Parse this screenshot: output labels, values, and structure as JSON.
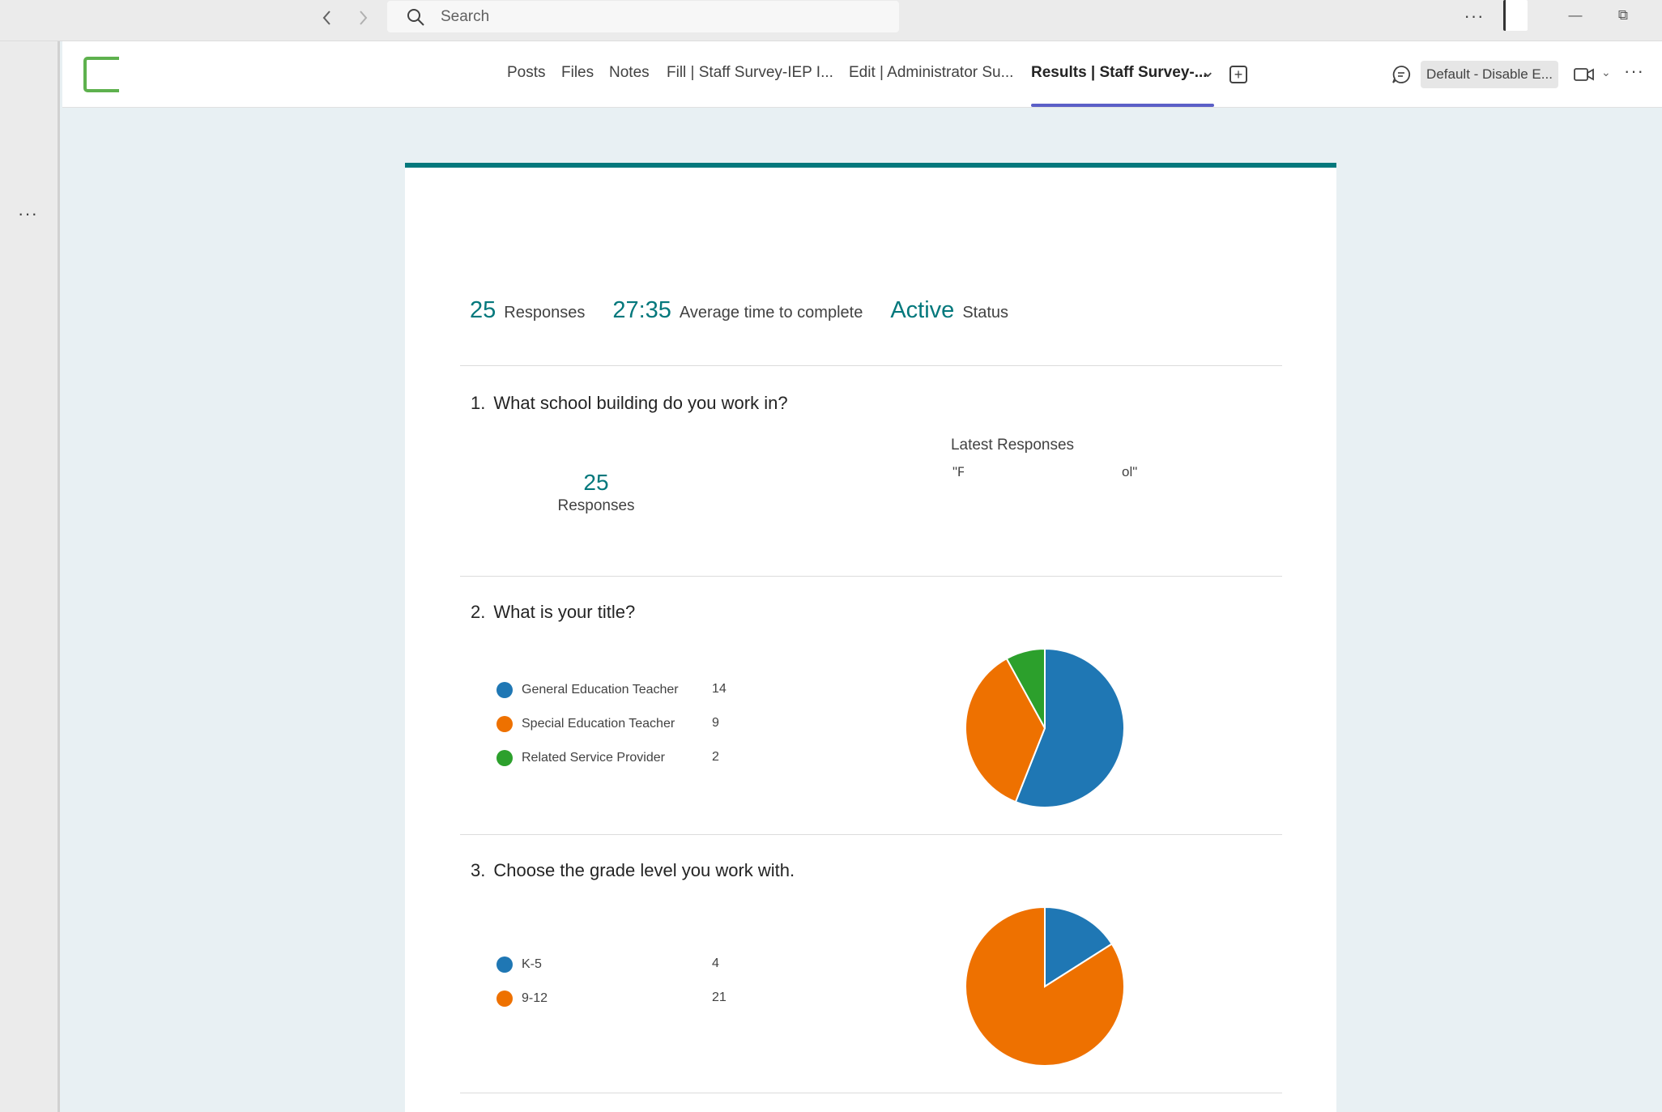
{
  "titlebar": {
    "back_icon": "chevron-left-icon",
    "forward_icon": "chevron-right-icon",
    "search_placeholder": "Search",
    "more_label": "···",
    "minimize_label": "—",
    "restore_label": "⧉"
  },
  "left_rail": {
    "more_label": "···"
  },
  "channel": {
    "tabs": [
      {
        "label": "Posts",
        "active": false
      },
      {
        "label": "Files",
        "active": false
      },
      {
        "label": "Notes",
        "active": false
      },
      {
        "label": "Fill | Staff Survey-IEP I...",
        "active": false
      },
      {
        "label": "Edit | Administrator Su...",
        "active": false
      },
      {
        "label": "Results | Staff Survey-...",
        "active": true
      }
    ],
    "tab_dropdown": "⌄",
    "add_tab_label": "+",
    "default_pill": "Default - Disable E...",
    "video_chevron": "⌄",
    "more_label": "···",
    "accent_color": "#5b5fc7"
  },
  "summary": {
    "responses_count": "25",
    "responses_label": "Responses",
    "avg_time": "27:35",
    "avg_time_label": "Average time to complete",
    "status_value": "Active",
    "status_label": "Status",
    "accent_color": "#03787c"
  },
  "questions": [
    {
      "number": "1.",
      "title": "What school building do you work in?",
      "responses_count": "25",
      "responses_label": "Responses",
      "latest_title": "Latest Responses",
      "latest_quote_start": "\"F",
      "latest_quote_end": "ol\""
    },
    {
      "number": "2.",
      "title": "What is your title?",
      "options": [
        {
          "label": "General Education Teacher",
          "count": "14",
          "color": "#1f77b4"
        },
        {
          "label": "Special Education Teacher",
          "count": "9",
          "color": "#ee7100"
        },
        {
          "label": "Related Service Provider",
          "count": "2",
          "color": "#2ca02c"
        }
      ]
    },
    {
      "number": "3.",
      "title": "Choose the grade level you work with.",
      "options": [
        {
          "label": "K-5",
          "count": "4",
          "color": "#1f77b4"
        },
        {
          "label": "9-12",
          "count": "21",
          "color": "#ee7100"
        }
      ]
    }
  ],
  "chart_data": [
    {
      "type": "pie",
      "title": "",
      "categories": [
        "General Education Teacher",
        "Special Education Teacher",
        "Related Service Provider"
      ],
      "values": [
        14,
        9,
        2
      ],
      "colors": [
        "#1f77b4",
        "#ee7100",
        "#2ca02c"
      ],
      "legend": "left"
    },
    {
      "type": "pie",
      "title": "",
      "categories": [
        "K-5",
        "9-12"
      ],
      "values": [
        4,
        21
      ],
      "colors": [
        "#1f77b4",
        "#ee7100"
      ],
      "legend": "left"
    }
  ]
}
